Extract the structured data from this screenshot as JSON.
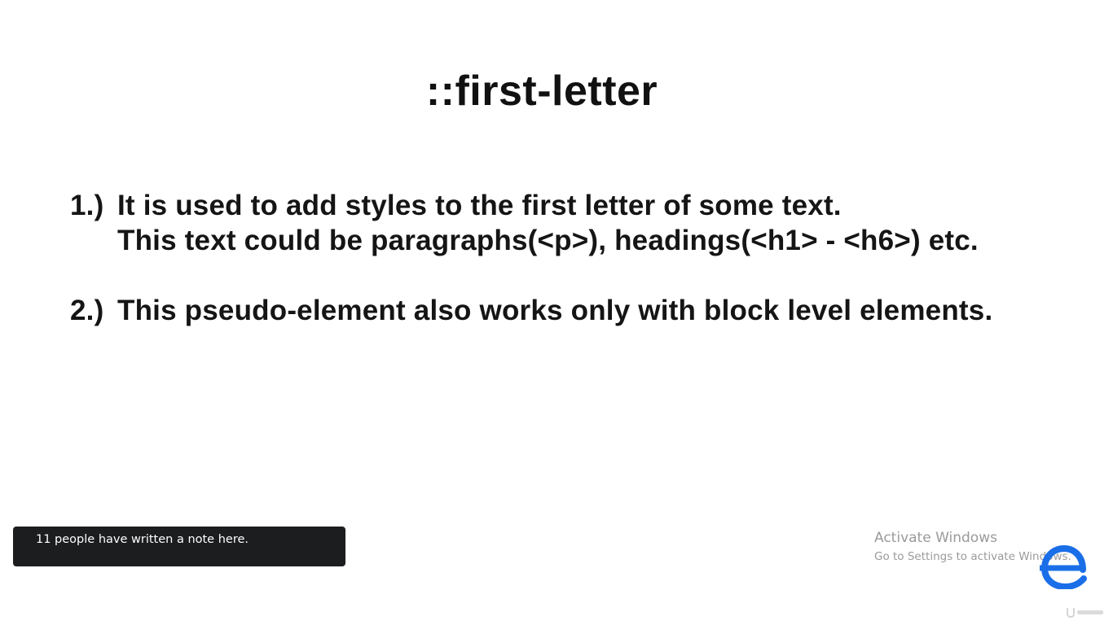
{
  "slide": {
    "title": "::first-letter",
    "points": [
      {
        "number": "1.)",
        "line1": "It is used to add styles to the first letter of some text.",
        "line2": "This text could be paragraphs(<p>), headings(<h1> - <h6>) etc."
      },
      {
        "number": "2.)",
        "line1": "This pseudo-element also works only with block level elements."
      }
    ]
  },
  "notes_toast": {
    "text": "11 people have written a note here."
  },
  "watermark": {
    "title": "Activate Windows",
    "subtitle": "Go to Settings to activate Windows."
  },
  "icons": {
    "logo": "edge-style-e-logo-icon",
    "corner": "udemy-watermark-icon"
  },
  "colors": {
    "slide_text": "#111111",
    "toast_bg": "#1c1d1f",
    "watermark_text": "#9a9a9a",
    "logo_blue": "#1a6fe8"
  }
}
